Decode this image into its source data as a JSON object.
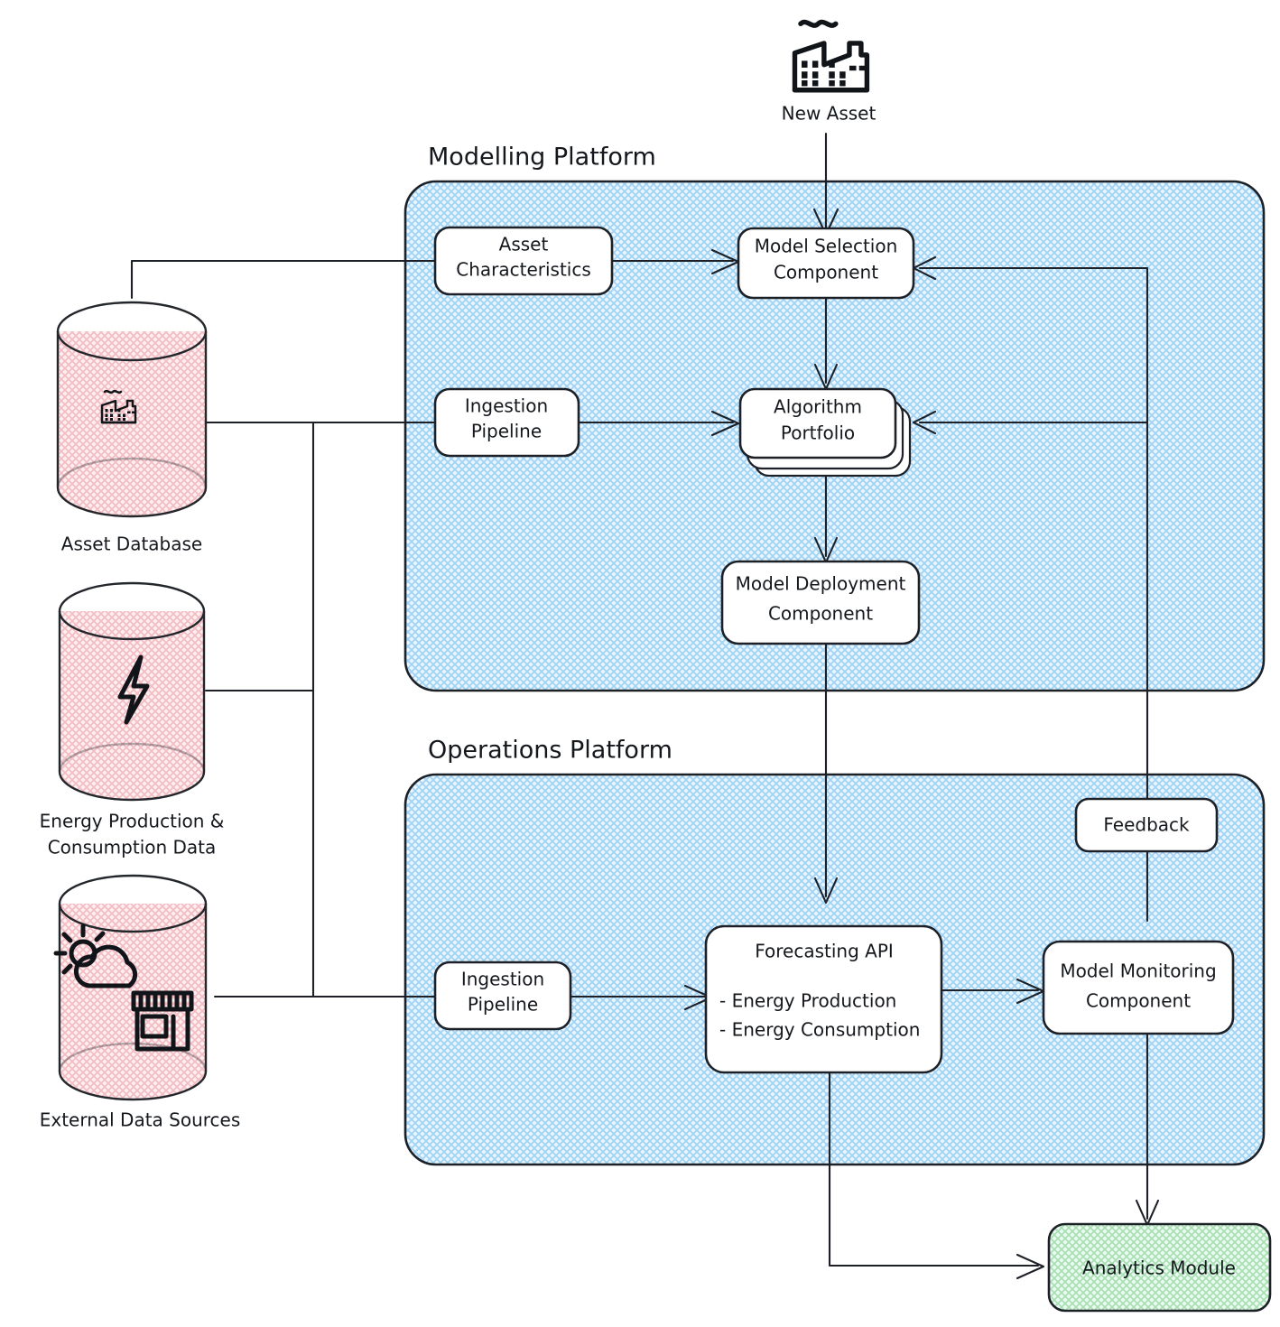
{
  "diagram": {
    "title_hidden": "",
    "colors": {
      "panel_fill": "#cfe8fa",
      "panel_stroke": "#1d2127",
      "db_fill": "#fadadd",
      "analytics_fill": "#c6eed0",
      "node_fill": "#ffffff",
      "line": "#1d2127"
    }
  },
  "top_asset": {
    "icon": "factory-icon",
    "label": "New Asset"
  },
  "groups": [
    {
      "id": "modelling",
      "title": "Modelling Platform"
    },
    {
      "id": "operations",
      "title": "Operations Platform"
    }
  ],
  "databases": [
    {
      "id": "asset-db",
      "icon": "factory-icon",
      "caption_lines": [
        "Asset Database"
      ]
    },
    {
      "id": "energy-db",
      "icon": "lightning-bolt-icon",
      "caption_lines": [
        "Energy Production &",
        "Consumption Data"
      ]
    },
    {
      "id": "external-db",
      "icon": "weather-store-icon",
      "caption_lines": [
        "External Data Sources"
      ]
    }
  ],
  "modelling_nodes": [
    {
      "id": "asset-characteristics",
      "lines": [
        "Asset",
        "Characteristics"
      ]
    },
    {
      "id": "ingestion-pipeline-modelling",
      "lines": [
        "Ingestion",
        "Pipeline"
      ]
    },
    {
      "id": "model-selection-component",
      "lines": [
        "Model Selection",
        "Component"
      ]
    },
    {
      "id": "algorithm-portfolio",
      "lines": [
        "Algorithm",
        "Portfolio"
      ],
      "stacked": true
    },
    {
      "id": "model-deployment-component",
      "lines": [
        "Model Deployment",
        "Component"
      ]
    }
  ],
  "operations_nodes": [
    {
      "id": "feedback",
      "lines": [
        "Feedback"
      ]
    },
    {
      "id": "ingestion-pipeline-operations",
      "lines": [
        "Ingestion",
        "Pipeline"
      ]
    },
    {
      "id": "forecasting-api",
      "title": "Forecasting API",
      "bullets": [
        "- Energy Production",
        "- Energy Consumption"
      ]
    },
    {
      "id": "model-monitoring-component",
      "lines": [
        "Model Monitoring",
        "Component"
      ]
    }
  ],
  "analytics": {
    "id": "analytics-module",
    "label": "Analytics Module"
  }
}
